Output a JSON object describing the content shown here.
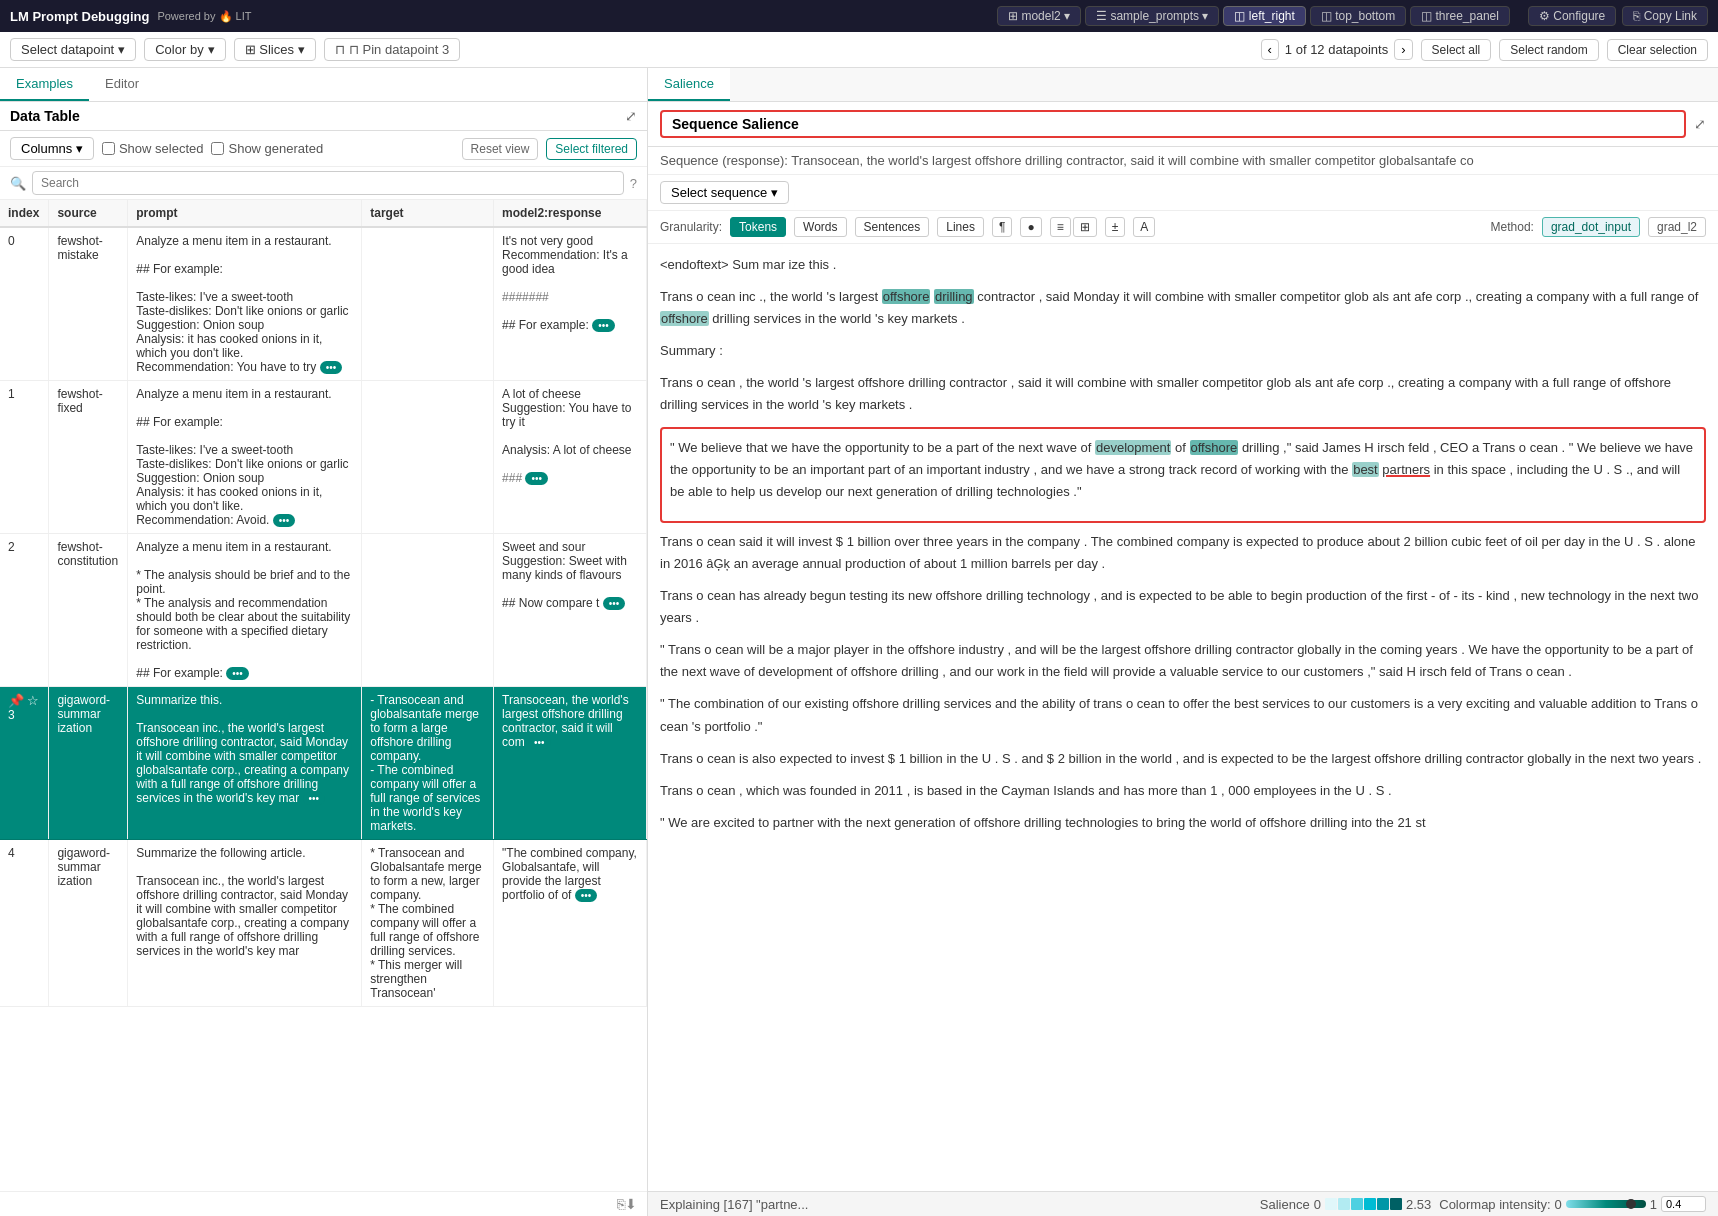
{
  "app": {
    "title": "LM Prompt Debugging",
    "powered_by": "Powered by 🔥 LIT"
  },
  "top_tabs": [
    {
      "label": "⊞ model2",
      "active": true
    },
    {
      "label": "☰ sample_prompts",
      "active": false
    },
    {
      "label": "◫ left_right",
      "active": true
    },
    {
      "label": "◫ top_bottom",
      "active": false
    },
    {
      "label": "◫ three_panel",
      "active": false
    }
  ],
  "top_actions": [
    {
      "label": "⚙ Configure"
    },
    {
      "label": "⎘ Copy Link"
    }
  ],
  "sub_toolbar": {
    "select_datapoint": "Select datapoint",
    "color_by": "Color by",
    "slices": "⊞ Slices",
    "pin": "⊓ Pin datapoint 3",
    "nav_info": "1 of 12 datapoints",
    "select_all": "Select all",
    "select_random": "Select random",
    "clear_selection": "Clear selection"
  },
  "left_panel": {
    "tabs": [
      "Examples",
      "Editor"
    ],
    "active_tab": "Examples",
    "data_table_title": "Data Table",
    "columns_btn": "Columns ▾",
    "show_selected": "Show selected",
    "show_generated": "Show generated",
    "reset_view": "Reset view",
    "select_filtered": "Select filtered",
    "search_placeholder": "Search",
    "columns": [
      "index",
      "source",
      "prompt",
      "target",
      "model2:response"
    ],
    "rows": [
      {
        "index": "0",
        "source": "fewshot-mistake",
        "prompt": "Analyze a menu item in a restaurant.\n\n## For example:\n\nTaste-likes: I've a sweet-tooth\nTaste-dislikes: Don't like onions or garlic\nSuggestion: Onion soup\nAnalysis: it has cooked onions in it, which you don't like.\nRecommendation: You have to try",
        "target": "",
        "model2_response": "It's not very good\nRecommendation: It's a good idea\n\n#######\n\n## For example:",
        "highlighted": false,
        "has_chip": true,
        "chip_count": "•••",
        "has_chip2": true,
        "chip_count2": "•••"
      },
      {
        "index": "1",
        "source": "fewshot-fixed",
        "prompt": "Analyze a menu item in a restaurant.\n\n## For example:\n\nTaste-likes: I've a sweet-tooth\nTaste-dislikes: Don't like onions or garlic\nSuggestion: Onion soup\nAnalysis: it has cooked onions in it, which you don't like.\nRecommendation: Avoid.",
        "target": "",
        "model2_response": "A lot of cheese\nSuggestion: You have to try it\n\nAnalysis: A lot of cheese\n\n###",
        "highlighted": false,
        "has_chip": true,
        "chip_count": "•••",
        "has_chip2": true,
        "chip_count2": "•••"
      },
      {
        "index": "2",
        "source": "fewshot-constitution",
        "prompt": "Analyze a menu item in a restaurant.\n\n* The analysis should be brief and to the point.\n* The analysis and recommendation should both be clear about the suitability for someone with a specified dietary restriction.\n\n## For example:",
        "target": "",
        "model2_response": "Sweet and sour\nSuggestion: Sweet with many kinds of flavours\n\n## Now compare t",
        "highlighted": false,
        "has_chip": true,
        "chip_count": "•••",
        "has_chip2": true,
        "chip_count2": "•••"
      },
      {
        "index": "3",
        "source": "gigaword-summarization",
        "prompt": "Summarize this.\n\nTransocean inc., the world's largest offshore drilling contractor, said Monday it will combine with smaller competitor globalsantafe corp., creating a company with a full range of offshore drilling services in the world's key mar",
        "target": "- Transocean and globalsantafe merge to form a large offshore drilling company.\n- The combined company will offer a full range of services in the world's key markets.",
        "model2_response": "Transocean, the world's largest offshore drilling contractor, said it will com",
        "highlighted": true,
        "has_chip": true,
        "chip_count": "•••",
        "has_chip2": true,
        "chip_count2": "•••",
        "pinned": true
      },
      {
        "index": "4",
        "source": "gigaword-summarization",
        "prompt": "Summarize the following article.\n\nTransocean inc., the world's largest offshore drilling contractor, said Monday it will combine with smaller competitor globalsantafe corp., creating a company with a full range of offshore drilling services in the world's key mar",
        "target": "* Transocean and Globalsantafe merge to form a new, larger company.\n* The combined company will offer a full range of offshore drilling services.\n* This merger will strengthen Transocean'",
        "model2_response": "\"The combined company, Globalsantafe, will provide the largest portfolio of of",
        "highlighted": false,
        "has_chip": false,
        "has_chip2": true,
        "chip_count2": "•••"
      }
    ]
  },
  "right_panel": {
    "tabs": [
      "Salience"
    ],
    "active_tab": "Salience",
    "title": "Sequence Salience",
    "sequence_info": "Sequence (response): Transocean, the world's largest offshore drilling contractor, said it will combine with smaller competitor globalsantafe co",
    "select_sequence_btn": "Select sequence ▾",
    "granularity": {
      "label": "Granularity:",
      "options": [
        "Tokens",
        "Words",
        "Sentences",
        "Lines"
      ],
      "active": "Tokens"
    },
    "method": {
      "label": "Method:",
      "options": [
        "grad_dot_input",
        "grad_l2"
      ],
      "active": "grad_dot_input"
    },
    "content": {
      "line1": "<endoftext> Sum mar ize this .",
      "paragraphs": [
        "Trans o cean inc ., the world 's largest offshore drilling contractor , said Monday it will combine with smaller competitor glob als ant afe corp ., creating a company with a full range of offshore drilling services in the world 's key markets .",
        "Summary :",
        "Trans o cean , the world 's largest offshore drilling contractor , said it will combine with smaller competitor glob als ant afe corp ., creating a company with a full range of offshore drilling services in the world 's key markets .",
        "\" We believe that we have the opportunity to be a part of the next wave of development of offshore drilling ,\" said James H irsch feld , CEO a Trans o cean . \" We believe we have the opportunity to be an important part of an important industry , and we have a strong track record of working with the best partners in this space , including the U . S ., and will be able to help us develop our next generation of drilling technologies .\"",
        "Trans o cean said it will invest $ 1 billion over three years in the company . The combined company is expected to produce about 2 billion cubic feet of oil per day in the U . S . alone in 2016 âĢķ an average annual production of about 1 million barrels per day .",
        "Trans o cean has already begun testing its new offshore drilling technology , and is expected to be able to begin production of the first - of - its - kind , new technology in the next two years .",
        "\" Trans o cean will be a major player in the offshore industry , and will be the largest offshore drilling contractor globally in the coming years . We have the opportunity to be a part of the next wave of development of offshore drilling , and our work in the field will provide a valuable service to our customers ,\" said H irsch feld of Trans o cean .",
        "\" The combination of our existing offshore drilling services and the ability of trans o cean to offer the best services to our customers is a very exciting and valuable addition to Trans o cean 's portfolio .\"",
        "Trans o cean is also expected to invest $ 1 billion in the U . S . and $ 2 billion in the world , and is expected to be the largest offshore drilling contractor globally in the next two years .",
        "Trans o cean , which was founded in 2011 , is based in the Cayman Islands and has more than 1 , 000 employees in the U . S .",
        "\" We are excited to partner with the next generation of offshore drilling technologies to bring the world of offshore drilling into the 21 st"
      ],
      "highlighted_section": "\" We believe that we have the opportunity to be a part of the next wave of development of offshore drilling ,\" said James H irsch feld , CEO a Trans o cean . \" We believe we have the opportunity to be an important part of an important industry , and we have a strong track record of working with the best partners in this space , including the U . S ., and will be able to help us develop our next generation of drilling technologies .\""
    },
    "bottom_bar": {
      "explaining": "Explaining [167] \"partne...",
      "salience_label": "Salience",
      "salience_value": "0",
      "colormap_label": "Colormap intensity:",
      "colormap_min": "0",
      "colormap_max": "1",
      "colormap_value": "0.4"
    }
  }
}
